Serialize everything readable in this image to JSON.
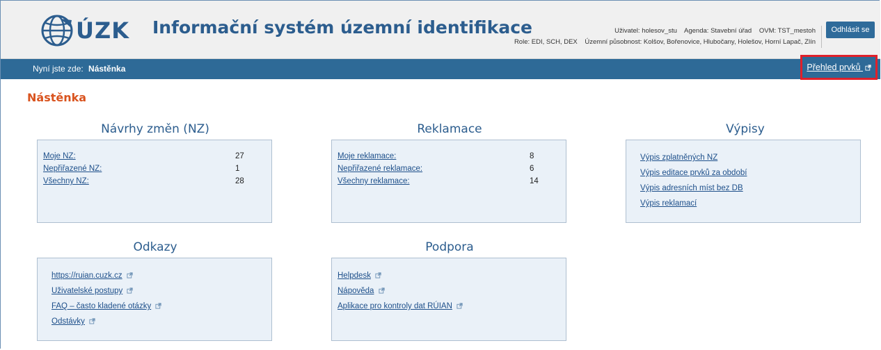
{
  "header": {
    "logo_text": "ÚZK",
    "app_title": "Informační systém územní identifikace",
    "user_label": "Uživatel: holesov_stu",
    "agenda_label": "Agenda: Stavební úřad",
    "ovm_label": "OVM: TST_mestoh",
    "role_label": "Role: EDI, SCH, DEX",
    "scope_label": "Územní působnost: Kolšov, Bořenovice, Hlubočany, Holešov, Horní Lapač, Zlín",
    "logout_label": "Odhlásit se"
  },
  "breadcrumb": {
    "prefix": "Nyní jste zde:",
    "current": "Nástěnka",
    "overview_link": "Přehled prvků"
  },
  "page": {
    "title": "Nástěnka"
  },
  "sections": {
    "nz": {
      "title": "Návrhy změn (NZ)",
      "rows": [
        {
          "label": "Moje NZ:",
          "value": "27"
        },
        {
          "label": "Nepřiřazené NZ:",
          "value": "1"
        },
        {
          "label": "Všechny NZ:",
          "value": "28"
        }
      ]
    },
    "reklamace": {
      "title": "Reklamace",
      "rows": [
        {
          "label": "Moje reklamace:",
          "value": "8"
        },
        {
          "label": "Nepřiřazené reklamace:",
          "value": "6"
        },
        {
          "label": "Všechny reklamace:",
          "value": "14"
        }
      ]
    },
    "vypisy": {
      "title": "Výpisy",
      "links": [
        "Výpis zplatněných NZ",
        "Výpis editace prvků za období",
        "Výpis adresních míst bez DB",
        "Výpis reklamací"
      ]
    },
    "odkazy": {
      "title": "Odkazy",
      "links": [
        "https://ruian.cuzk.cz",
        "Uživatelské postupy",
        "FAQ – často kladené otázky",
        "Odstávky"
      ]
    },
    "podpora": {
      "title": "Podpora",
      "links": [
        "Helpdesk",
        "Nápověda",
        "Aplikace pro kontroly dat RÚIAN"
      ]
    }
  },
  "colors": {
    "brand_blue": "#2c5d8e",
    "bar_blue": "#2e6a97",
    "title_orange": "#d9531e",
    "box_bg": "#eaf1f8",
    "highlight_red": "#e0202a"
  },
  "icons": {
    "logo": "cuzk-globe-logo",
    "external": "external-link-icon"
  }
}
